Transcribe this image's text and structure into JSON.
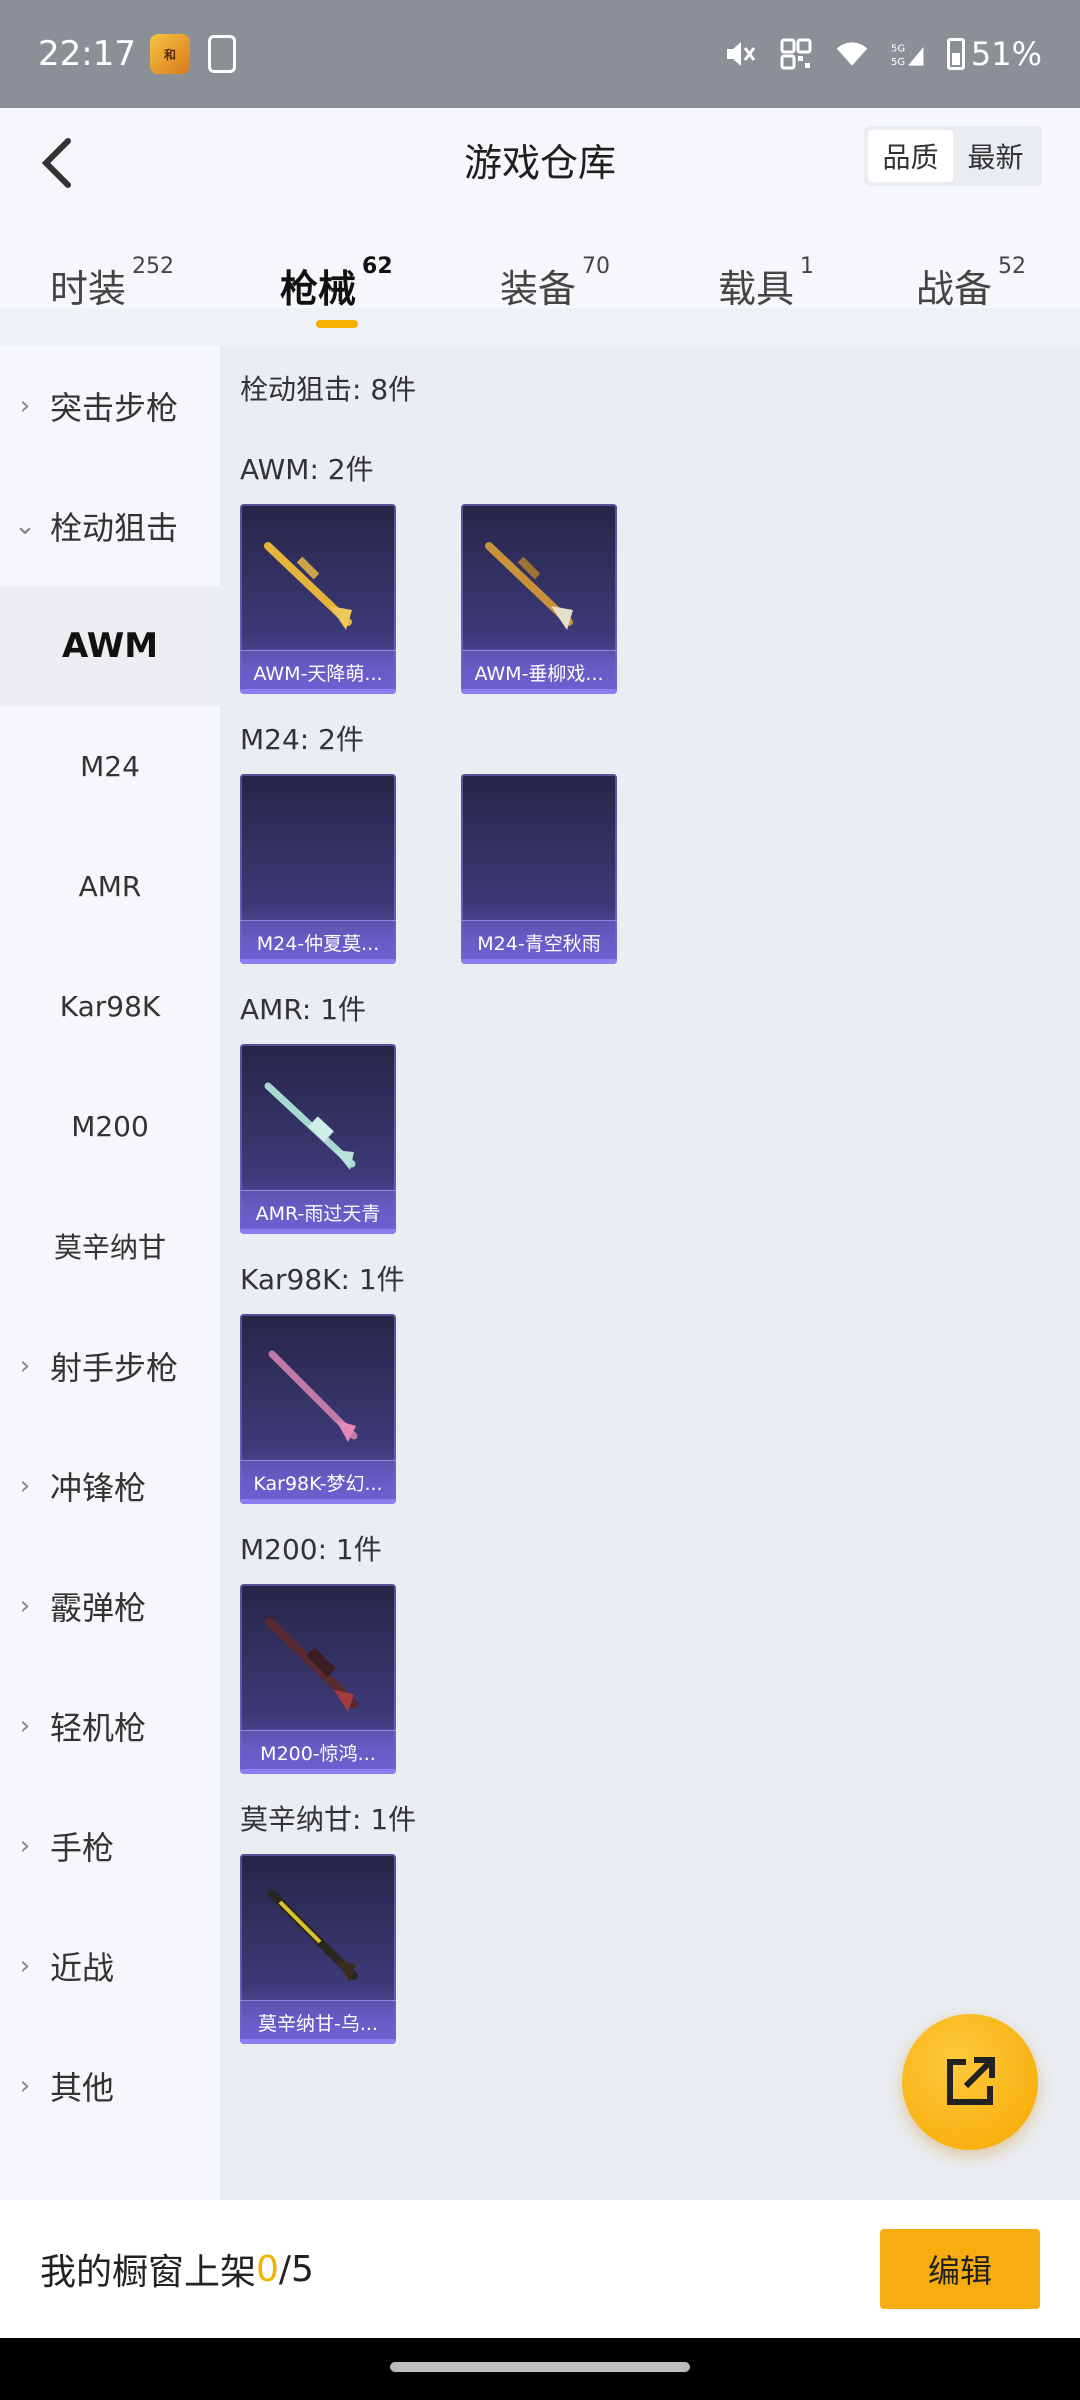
{
  "status": {
    "time": "22:17",
    "battery": "51%",
    "icons": [
      "game-app-icon",
      "phone-sync-icon",
      "mute-icon",
      "nfc-icon",
      "wifi-icon",
      "signal-5g-icon",
      "battery-icon"
    ]
  },
  "header": {
    "title": "游戏仓库",
    "sort_options": [
      "品质",
      "最新"
    ],
    "active_sort": "品质"
  },
  "tabs": [
    {
      "label": "时装",
      "count": "252"
    },
    {
      "label": "枪械",
      "count": "62",
      "active": true
    },
    {
      "label": "装备",
      "count": "70"
    },
    {
      "label": "载具",
      "count": "1"
    },
    {
      "label": "战备",
      "count": "52"
    }
  ],
  "sidebar": {
    "items": [
      {
        "label": "突击步枪",
        "type": "group",
        "expanded": false
      },
      {
        "label": "栓动狙击",
        "type": "group",
        "expanded": true
      },
      {
        "label": "AWM",
        "type": "sub",
        "active": true
      },
      {
        "label": "M24",
        "type": "sub"
      },
      {
        "label": "AMR",
        "type": "sub"
      },
      {
        "label": "Kar98K",
        "type": "sub"
      },
      {
        "label": "M200",
        "type": "sub"
      },
      {
        "label": "莫辛纳甘",
        "type": "sub"
      },
      {
        "label": "射手步枪",
        "type": "group"
      },
      {
        "label": "冲锋枪",
        "type": "group"
      },
      {
        "label": "霰弹枪",
        "type": "group"
      },
      {
        "label": "轻机枪",
        "type": "group"
      },
      {
        "label": "手枪",
        "type": "group"
      },
      {
        "label": "近战",
        "type": "group"
      },
      {
        "label": "其他",
        "type": "group"
      }
    ]
  },
  "content": {
    "section_title": "栓动狙击: 8件",
    "groups": [
      {
        "label": "AWM: 2件",
        "items": [
          "AWM-天降萌...",
          "AWM-垂柳戏..."
        ]
      },
      {
        "label": "M24: 2件",
        "items": [
          "M24-仲夏莫...",
          "M24-青空秋雨"
        ]
      },
      {
        "label": "AMR: 1件",
        "items": [
          "AMR-雨过天青"
        ]
      },
      {
        "label": "Kar98K: 1件",
        "items": [
          "Kar98K-梦幻..."
        ]
      },
      {
        "label": "M200: 1件",
        "items": [
          "M200-惊鸿..."
        ]
      },
      {
        "label": "莫辛纳甘: 1件",
        "items": [
          "莫辛纳甘-乌..."
        ]
      }
    ]
  },
  "fab": {
    "icon": "share-external-icon"
  },
  "bottom": {
    "label": "我的橱窗上架 ",
    "count": "0",
    "total": "/5",
    "edit_label": "编辑"
  },
  "colors": {
    "accent": "#f5b100",
    "card_bg": "#3e3a7a"
  }
}
